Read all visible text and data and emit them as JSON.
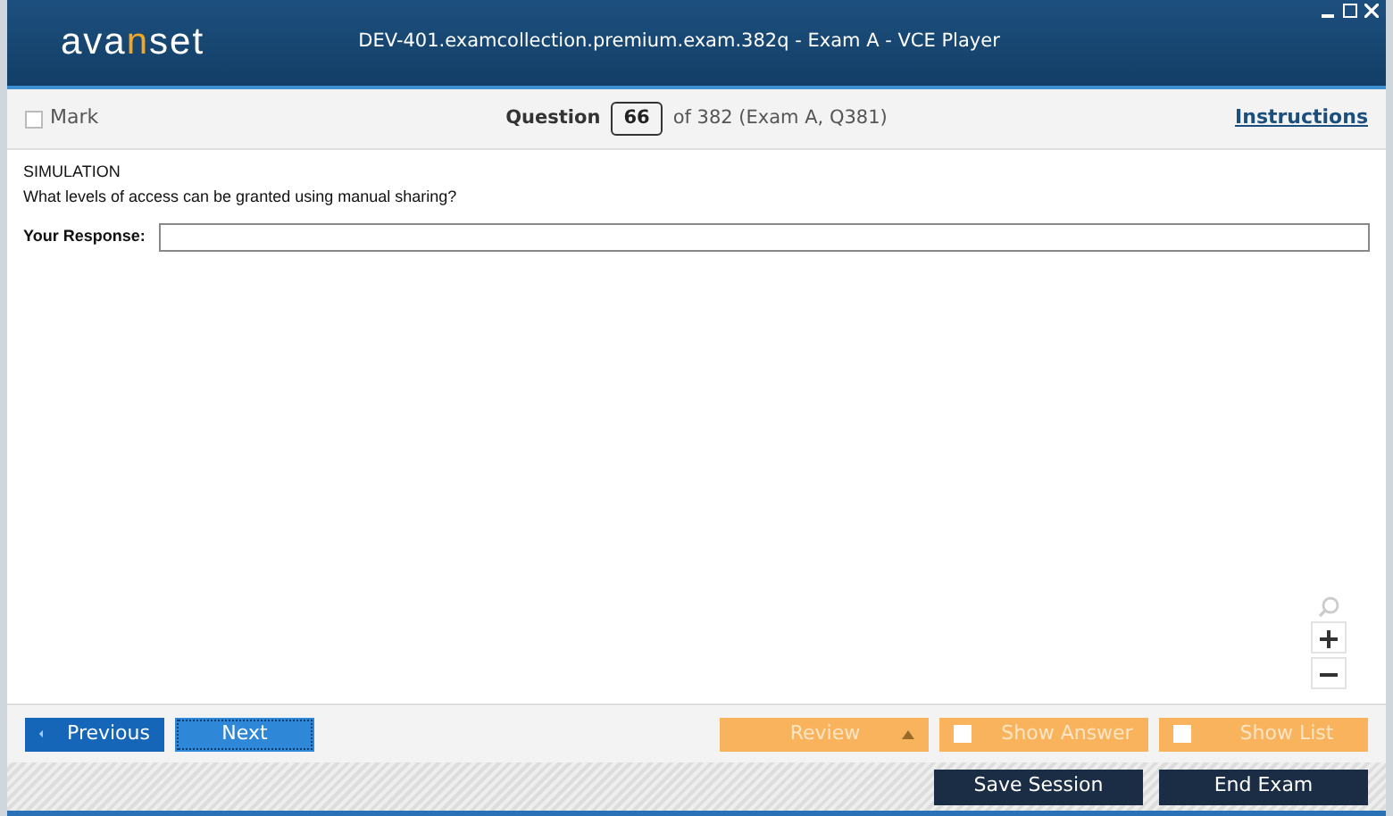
{
  "window": {
    "title": "DEV-401.examcollection.premium.exam.382q - Exam A - VCE Player",
    "logo": [
      {
        "text": "ava",
        "accent": false
      },
      {
        "text": "n",
        "accent": true
      },
      {
        "text": "set",
        "accent": false
      }
    ]
  },
  "toolbar": {
    "mark": {
      "label": "Mark",
      "checked": false
    },
    "question_label": "Question",
    "question_number": "66",
    "question_of": "of 382 (Exam A, Q381)",
    "instructions": "Instructions"
  },
  "question": {
    "type": "SIMULATION",
    "text": "What levels of access can be granted using manual sharing?",
    "response_label": "Your Response:"
  },
  "nav_buttons": [
    {
      "label": "Previous",
      "kind": "prev",
      "focused": false
    },
    {
      "label": "Next",
      "kind": "next",
      "focused": true
    }
  ],
  "option_buttons": [
    {
      "label": "Review",
      "kind": "dropdown"
    },
    {
      "label": "Show Answer",
      "kind": "checkbox",
      "checked": false
    },
    {
      "label": "Show List",
      "kind": "checkbox",
      "checked": false
    }
  ],
  "footer_buttons": [
    {
      "label": "Save Session"
    },
    {
      "label": "End Exam"
    }
  ]
}
